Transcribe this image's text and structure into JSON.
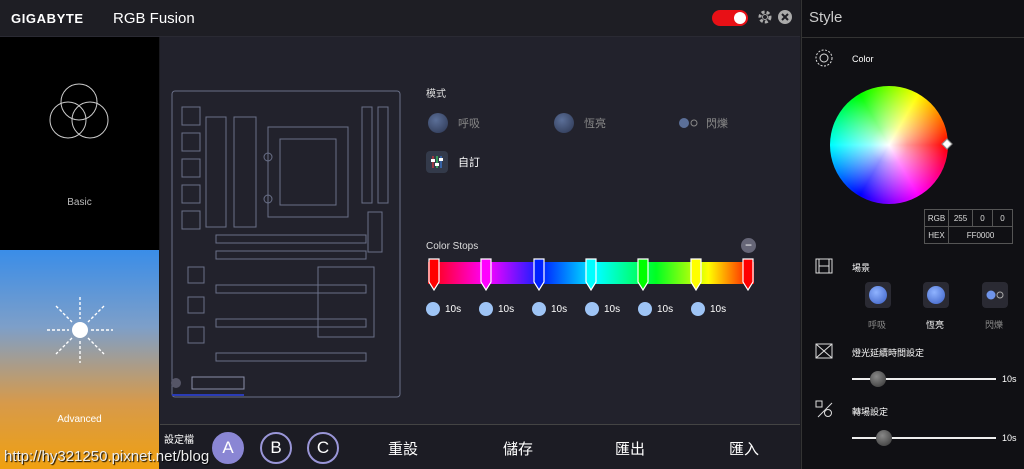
{
  "titlebar": {
    "logo": "GIGABYTE",
    "app_title": "RGB Fusion",
    "power_on": true,
    "icons": [
      "gear-icon",
      "close-icon"
    ]
  },
  "left_panel": {
    "modes": [
      {
        "label": "Basic",
        "icon": "venn-circles-icon"
      },
      {
        "label": "Advanced",
        "icon": "sunburst-icon"
      }
    ]
  },
  "main": {
    "mode_label": "模式",
    "options": [
      {
        "label": "呼吸",
        "icon": "breathing-icon"
      },
      {
        "label": "恆亮",
        "icon": "static-icon"
      },
      {
        "label": "閃爍",
        "icon": "flash-icon"
      },
      {
        "label": "自訂",
        "icon": "sliders-icon"
      }
    ],
    "color_stops_label": "Color Stops",
    "color_stops_remove": "−",
    "stop_colors": [
      "#ff0000",
      "#ff00ff",
      "#0022ff",
      "#00ffff",
      "#00ff00",
      "#ffff00",
      "#ff0000"
    ],
    "durations": [
      "10s",
      "10s",
      "10s",
      "10s",
      "10s",
      "10s"
    ]
  },
  "bottombar": {
    "profile_label": "設定檔",
    "profiles": [
      "A",
      "B",
      "C"
    ],
    "buttons": [
      "重設",
      "儲存",
      "匯出",
      "匯入"
    ]
  },
  "right_panel": {
    "title": "Style",
    "color_label": "Color",
    "rgb_label": "RGB",
    "rgb_values": [
      "255",
      "0",
      "0"
    ],
    "hex_label": "HEX",
    "hex_value": "FF0000",
    "scene_label": "場景",
    "scenes": [
      "呼吸",
      "恆亮",
      "閃爍"
    ],
    "delay_label": "燈光延續時間設定",
    "delay_value": "10s",
    "transition_label": "轉場設定",
    "transition_value": "10s",
    "accent": "#e81016"
  },
  "watermark": "http://hy321250.pixnet.net/blog"
}
